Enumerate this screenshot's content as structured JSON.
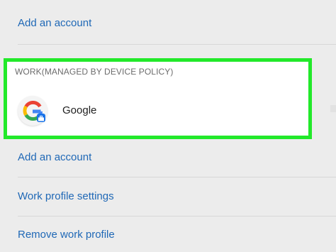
{
  "accounts_top": {
    "add_account_label": "Add an account"
  },
  "work_section": {
    "header": "WORK(MANAGED BY DEVICE POLICY)",
    "account": {
      "name": "Google",
      "icon": "google-icon",
      "badge": "briefcase-icon"
    }
  },
  "actions": {
    "add_account_label": "Add an account",
    "work_profile_settings_label": "Work profile settings",
    "remove_work_profile_label": "Remove work profile"
  },
  "colors": {
    "background": "#ececec",
    "link": "#1f68b6",
    "highlight": "#22e92a",
    "google_blue": "#4285f4",
    "google_red": "#ea4335",
    "google_yellow": "#fbbc05",
    "google_green": "#34a853"
  }
}
